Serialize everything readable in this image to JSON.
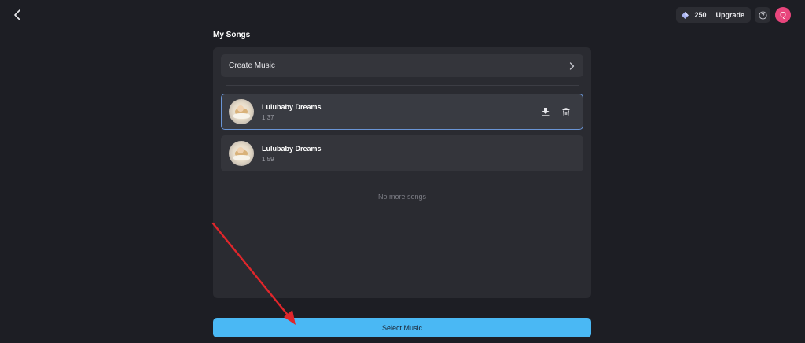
{
  "header": {
    "credits": "250",
    "upgrade_label": "Upgrade",
    "avatar_initial": "Q"
  },
  "section": {
    "title": "My Songs"
  },
  "create_row": {
    "label": "Create Music"
  },
  "songs": [
    {
      "title": "Lulubaby Dreams",
      "duration": "1:37",
      "selected": true
    },
    {
      "title": "Lulubaby Dreams",
      "duration": "1:59",
      "selected": false
    }
  ],
  "empty_note": "No more songs",
  "primary_action": {
    "label": "Select Music"
  },
  "colors": {
    "background": "#1d1e24",
    "panel": "#2a2b31",
    "accent": "#4ab8f4",
    "avatar": "#e8457c",
    "selected_border": "#6a95d6",
    "annotation_arrow": "#e0262b"
  },
  "icons": [
    "back-arrow-icon",
    "diamond-icon",
    "help-icon",
    "chevron-right-icon",
    "download-icon",
    "trash-icon"
  ]
}
